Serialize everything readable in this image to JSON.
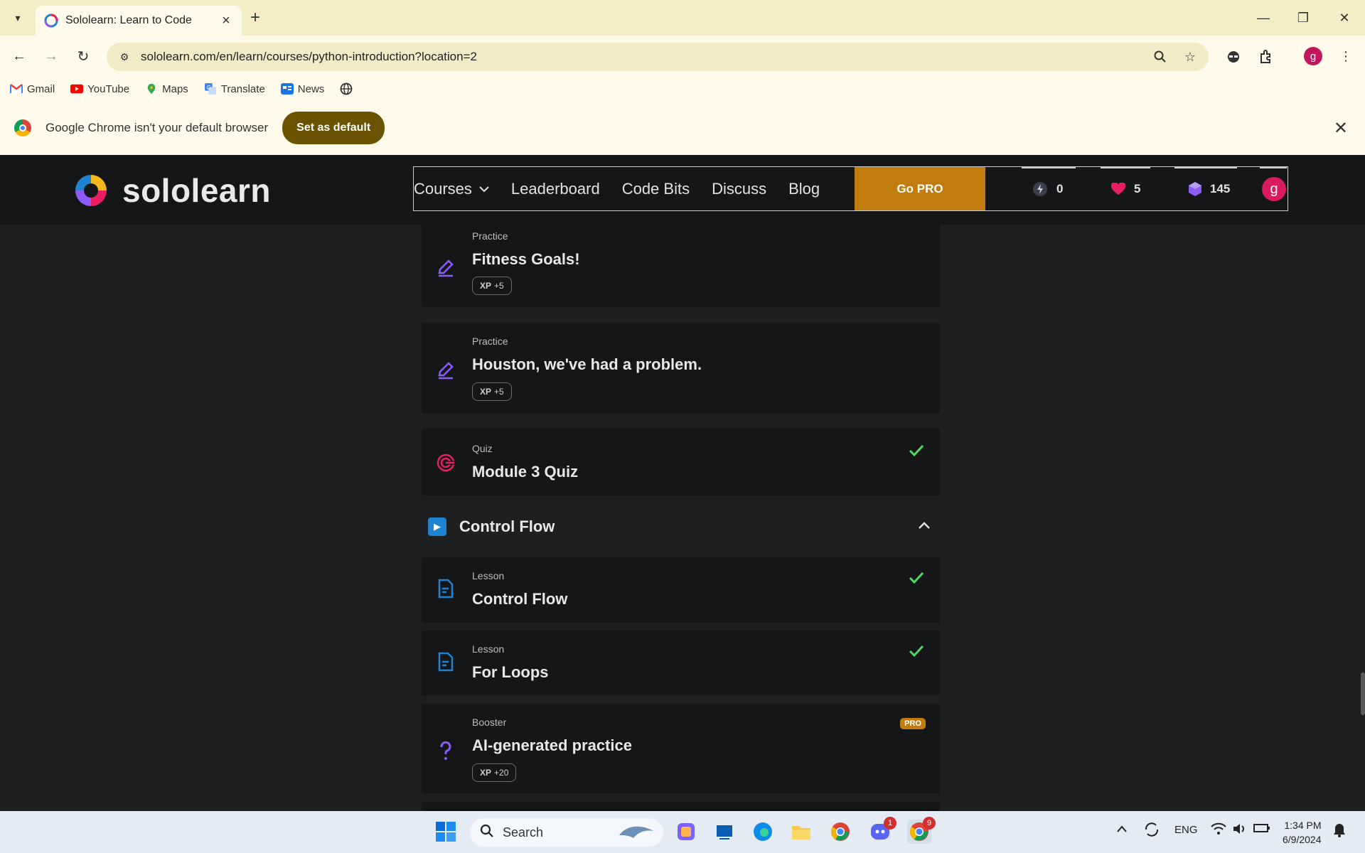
{
  "browser": {
    "tab_title": "Sololearn: Learn to Code",
    "url": "sololearn.com/en/learn/courses/python-introduction?location=2",
    "bookmarks": [
      {
        "label": "Gmail",
        "color": "#ea4335"
      },
      {
        "label": "YouTube",
        "color": "#ff0000"
      },
      {
        "label": "Maps",
        "color": "#34a853"
      },
      {
        "label": "Translate",
        "color": "#4285f4"
      },
      {
        "label": "News",
        "color": "#1a73e8"
      }
    ],
    "banner_text": "Google Chrome isn't your default browser",
    "banner_button": "Set as default",
    "profile_initial": "g"
  },
  "header": {
    "logo_text": "sololearn",
    "nav": {
      "courses": "Courses",
      "leaderboard": "Leaderboard",
      "code_bits": "Code Bits",
      "discuss": "Discuss",
      "blog": "Blog",
      "go_pro": "Go PRO"
    },
    "stats": {
      "streak": "0",
      "hearts": "5",
      "gems": "145"
    },
    "avatar_initial": "g"
  },
  "items": [
    {
      "type": "Practice",
      "title": "Fitness Goals!",
      "xp_label": "XP",
      "xp": "+5",
      "icon": "pencil-icon"
    },
    {
      "type": "Practice",
      "title": "Houston, we've had a problem.",
      "xp_label": "XP",
      "xp": "+5",
      "icon": "pencil-icon"
    },
    {
      "type": "Quiz",
      "title": "Module 3 Quiz",
      "completed": true,
      "icon": "target-icon"
    }
  ],
  "section": {
    "title": "Control Flow",
    "expanded": true
  },
  "section_items": [
    {
      "type": "Lesson",
      "title": "Control Flow",
      "completed": true,
      "icon": "lesson-icon"
    },
    {
      "type": "Lesson",
      "title": "For Loops",
      "completed": true,
      "icon": "lesson-icon"
    },
    {
      "type": "Booster",
      "title": "AI-generated practice",
      "xp_label": "XP",
      "xp": "+20",
      "badge": "PRO",
      "icon": "question-icon"
    }
  ],
  "colors": {
    "accent_purple": "#8b5cf6",
    "accent_blue": "#1f83d1",
    "check_green": "#4cd964",
    "pro_orange": "#c27c0e",
    "quiz_red": "#e91e63"
  },
  "taskbar": {
    "search_label": "Search",
    "discord_badge": "1",
    "chrome_badge": "9",
    "language": "ENG",
    "time": "1:34 PM",
    "date": "6/9/2024"
  }
}
